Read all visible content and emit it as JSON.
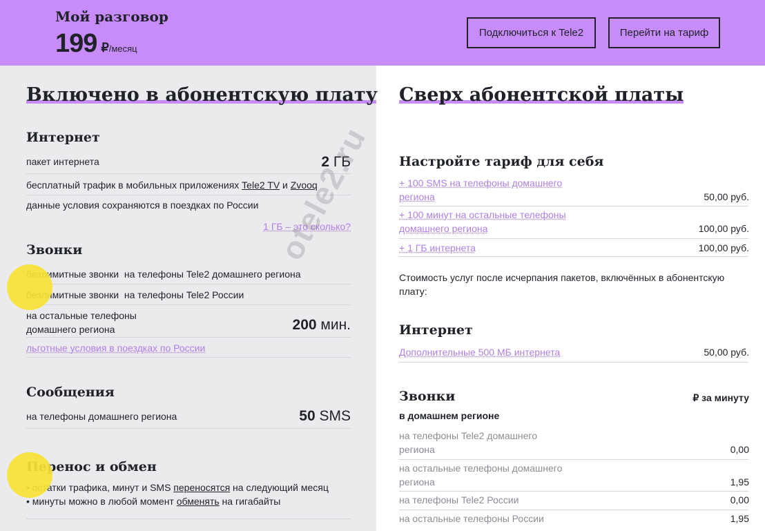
{
  "header": {
    "plan_name": "Мой разговор",
    "price": "199",
    "currency": "₽",
    "price_unit": "/месяц",
    "connect_button": "Подключиться к Tele2",
    "tariff_button": "Перейти на тариф"
  },
  "left": {
    "title": "Включено в абонентскую плату",
    "internet": {
      "heading": "Интернет",
      "package_label": "пакет интернета",
      "package_value_num": "2",
      "package_value_unit": " ГБ",
      "free_traffic_prefix": "бесплатный трафик в мобильных приложениях ",
      "free_traffic_app1": "Tele2 TV",
      "free_traffic_and": " и ",
      "free_traffic_app2": "Zvooq",
      "trips_note": "данные условия сохраняются в поездках по России",
      "how_much_link": "1 ГБ – это сколько?"
    },
    "calls": {
      "heading": "Звонки",
      "row1": "безлимитные звонки  на телефоны Tele2 домашнего региона",
      "row2": "безлимитные звонки  на телефоны Tele2 России",
      "row3_line1": "на остальные телефоны",
      "row3_line2": "домашнего региона",
      "row3_value_num": "200",
      "row3_value_unit": " мин.",
      "trips_link": "льготные условия в поездках по России"
    },
    "sms": {
      "heading": "Сообщения",
      "label": "на телефоны домашнего региона",
      "value_num": "50",
      "value_unit": " SMS"
    },
    "transfer": {
      "heading": "Перенос и обмен",
      "line1_prefix": "• остатки трафика, минут и SMS ",
      "line1_link": "переносятся",
      "line1_suffix": " на следующий месяц",
      "line2_prefix": "• минуты можно в любой момент ",
      "line2_link": "обменять",
      "line2_suffix": " на гигабайты"
    }
  },
  "right": {
    "title": "Сверх абонентской платы",
    "customize": {
      "heading": "Настройте тариф для себя",
      "opt1_line1": "+ 100 SMS на телефоны домашнего",
      "opt1_line2": "региона",
      "opt1_price": "50,00 руб.",
      "opt2_line1": "+ 100 минут на остальные телефоны",
      "opt2_line2": "домашнего региона",
      "opt2_price": "100,00 руб.",
      "opt3": "+ 1 ГБ интернета",
      "opt3_price": "100,00 руб."
    },
    "after_packages_note": "Стоимость услуг после исчерпания пакетов, включённых в абонентскую плату:",
    "internet": {
      "heading": "Интернет",
      "extra_link": "Дополнительные 500 МБ интернета",
      "extra_price": "50,00 руб."
    },
    "calls": {
      "heading": "Звонки",
      "per_minute": "₽ за минуту",
      "home_region": "в домашнем регионе",
      "r1_line1": "на телефоны Tele2 домашнего",
      "r1_line2": "региона",
      "r1_price": "0,00",
      "r2_line1": "на остальные телефоны домашнего",
      "r2_line2": "региона",
      "r2_price": "1,95",
      "r3": "на телефоны Tele2 России",
      "r3_price": "0,00",
      "r4": "на остальные телефоны России",
      "r4_price": "1,95"
    }
  },
  "watermark": "otele2.ru",
  "colors": {
    "accent": "#c88cf8",
    "link": "#b07fe6",
    "highlight": "#f7e235"
  }
}
